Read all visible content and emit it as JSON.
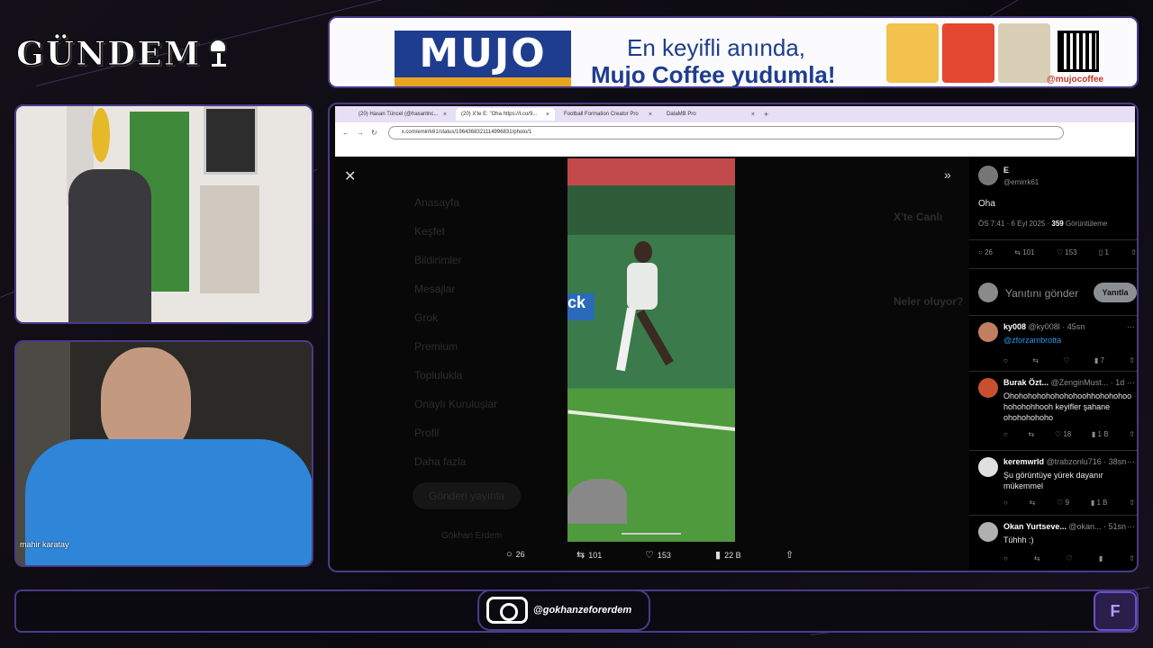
{
  "overlay": {
    "logo_text": "GÜNDEM",
    "cam_label": "mahir karatay",
    "instagram_handle": "@gokhanzeforerdem",
    "brand_mark": "F"
  },
  "ad": {
    "brand": "MUJO",
    "line1": "En keyifli anında,",
    "line2": "Mujo Coffee yudumla!",
    "social": "@mujocoffee"
  },
  "browser": {
    "tabs": [
      {
        "label": "(20) Hasan Tüncel (@hasantnc..."
      },
      {
        "label": "(20) X'te E: \"Oha https://t.co/9..."
      },
      {
        "label": "Football Formation Creator Pro"
      },
      {
        "label": "DataMB Pro"
      }
    ],
    "url": "x.com/emirrk61/status/1964368321114996831/photo/1"
  },
  "x_bg": {
    "menu": [
      "Anasayfa",
      "Keşfet",
      "Bildirimler",
      "Mesajlar",
      "Grok",
      "Premium",
      "Toplulukla",
      "Onaylı Kuruluşlar",
      "Profil",
      "Daha fazla"
    ],
    "post_button": "Gönderi yayınla",
    "profile": "Gökhan Erdem",
    "right_title": "X'te Canlı",
    "right_title2": "Neler oluyor?"
  },
  "video_actions": {
    "replies": "26",
    "reposts": "101",
    "likes": "153",
    "views": "22 B"
  },
  "post": {
    "name": "E",
    "handle": "@emirrk61",
    "text": "Oha",
    "time": "ÖS 7:41 · 6 Eyl 2025 · ",
    "views_count": "359",
    "views_label": " Görüntüleme",
    "replies": "26",
    "reposts": "101",
    "likes": "153",
    "bookmarks": "1"
  },
  "reply": {
    "placeholder": "Yanıtını gönder",
    "button": "Yanıtla"
  },
  "comments": [
    {
      "name": "ky008",
      "meta": "@ky008l · 45sn",
      "body": "@zforzambrotta",
      "views": "7",
      "likes": ""
    },
    {
      "name": "Burak Özt...",
      "meta": "@ZenginMust... · 1d",
      "body": "Ohohohohohohohohoohhohohohoo hohohohhooh keyifler şahane ohohohohoho",
      "views": "1 B",
      "likes": "18"
    },
    {
      "name": "keremwrld",
      "meta": "@trabzonlu716 · 38sn",
      "body": "Şu görüntüye yürek dayanır mükemmel",
      "views": "1 B",
      "likes": "9"
    },
    {
      "name": "Okan Yurtseve...",
      "meta": "@okan... · 51sn",
      "body": "Tühhh :)",
      "views": "",
      "likes": ""
    }
  ]
}
